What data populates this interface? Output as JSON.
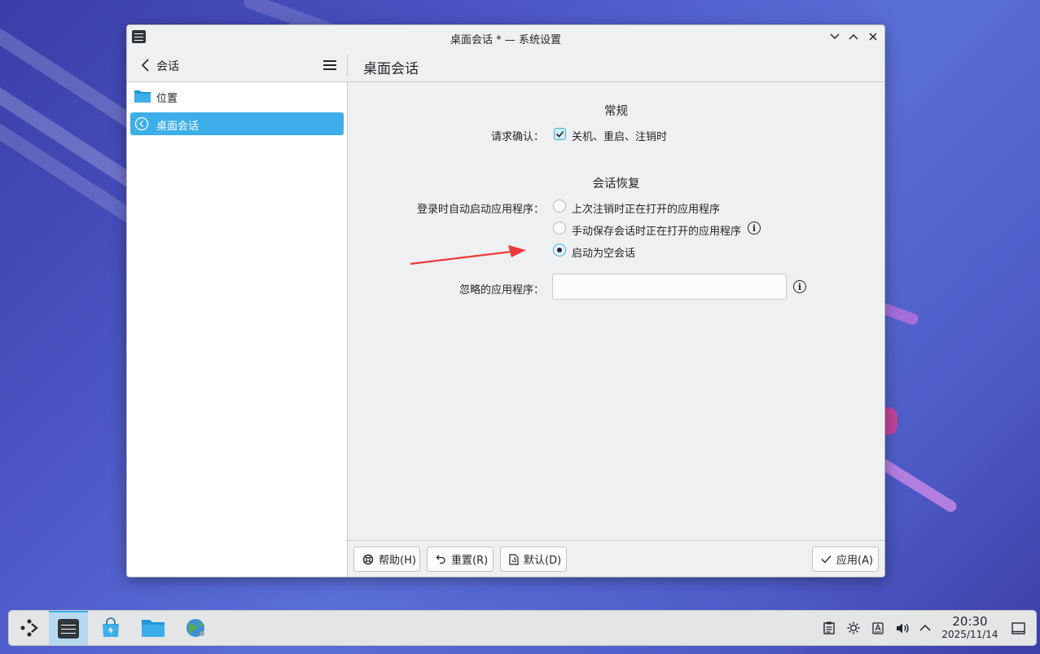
{
  "window": {
    "title": "桌面会话 * — 系统设置"
  },
  "toolbar": {
    "breadcrumb": "会话",
    "page_title": "桌面会话"
  },
  "sidebar": {
    "items": [
      {
        "label": "位置",
        "icon": "folder-icon"
      },
      {
        "label": "桌面会话",
        "icon": "back-circle-icon",
        "selected": true
      }
    ]
  },
  "general": {
    "heading": "常规",
    "confirm_label": "请求确认：",
    "confirm_option": "关机、重启、注销时",
    "confirm_checked": true
  },
  "restore": {
    "heading": "会话恢复",
    "autostart_label": "登录时自动启动应用程序：",
    "options": [
      "上次注销时正在打开的应用程序",
      "手动保存会话时正在打开的应用程序",
      "启动为空会话"
    ],
    "selected_index": 2,
    "ignored_label": "忽略的应用程序：",
    "ignored_value": ""
  },
  "footer": {
    "help": "帮助(H)",
    "reset": "重置(R)",
    "defaults": "默认(D)",
    "apply": "应用(A)"
  },
  "taskbar": {
    "time": "20:30",
    "date": "2025/11/14"
  },
  "colors": {
    "accent": "#3daee9",
    "annotation_arrow": "#ee3a3a"
  }
}
